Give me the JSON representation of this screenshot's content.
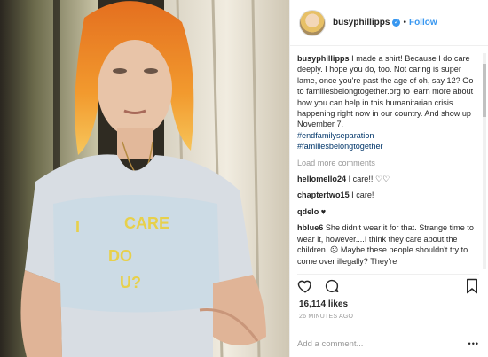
{
  "post": {
    "username": "busyphillipps",
    "follow_label": "Follow",
    "separator": "•",
    "verified_glyph": "✓",
    "caption_user": "busyphillipps",
    "caption_text": "I made a shirt! Because I do care deeply. I hope you do, too. Not caring is super lame, once you're past the age of oh, say 12? Go to familiesbelongtogether.org to learn more about how you can help in this humanitarian crisis happening right now in our country. And show up November 7.",
    "hashtag1": "#endfamilyseparation",
    "hashtag2": "#familiesbelongtogether",
    "load_more": "Load more comments",
    "comments": [
      {
        "user": "hellomello24",
        "text": "I care!! ♡♡"
      },
      {
        "user": "chaptertwo15",
        "text": "I care!"
      },
      {
        "user": "qdelo",
        "text": "♥"
      },
      {
        "user": "hblue6",
        "text": "She didn't wear it for that. Strange time to wear it, however....I think they care about the children. ☹ Maybe these people shouldn't try to come over illegally? They're"
      }
    ],
    "likes": "16,114 likes",
    "timestamp": "26 MINUTES AGO",
    "add_comment_placeholder": "Add a comment...",
    "more_glyph": "•••"
  },
  "shirt_text": [
    "I",
    "CARE",
    "DO",
    "U?"
  ],
  "colors": {
    "accent": "#3897f0",
    "hashtag": "#003569",
    "muted": "#999999"
  }
}
